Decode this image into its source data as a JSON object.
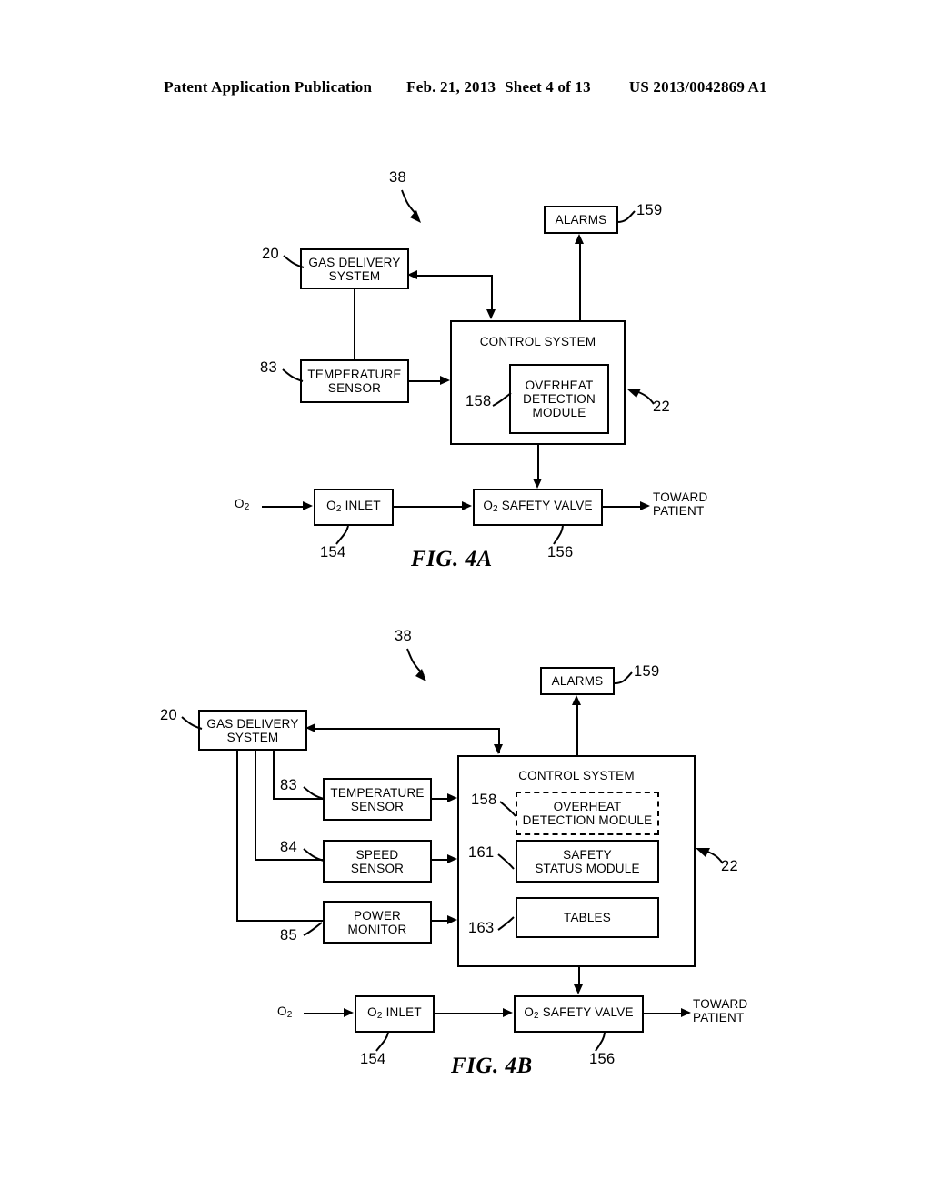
{
  "header": {
    "publication": "Patent Application Publication",
    "date": "Feb. 21, 2013",
    "sheet": "Sheet 4 of 13",
    "docnum": "US 2013/0042869 A1"
  },
  "figures": [
    {
      "id": "fig4a",
      "caption": "FIG. 4A",
      "system_ref": "38",
      "nodes": {
        "gas_delivery": {
          "label": "GAS DELIVERY\nSYSTEM",
          "ref": "20"
        },
        "temperature_sensor": {
          "label": "TEMPERATURE\nSENSOR",
          "ref": "83"
        },
        "alarms": {
          "label": "ALARMS",
          "ref": "159"
        },
        "control_system": {
          "label": "CONTROL SYSTEM",
          "ref": "22"
        },
        "overheat_module": {
          "label": "OVERHEAT\nDETECTION\nMODULE",
          "ref": "158"
        },
        "o2_inlet": {
          "label": "O2 INLET",
          "ref": "154"
        },
        "o2_safety_valve": {
          "label": "O2 SAFETY VALVE",
          "ref": "156"
        }
      },
      "texts": {
        "o2_source": "O2",
        "toward_patient": "TOWARD\nPATIENT"
      }
    },
    {
      "id": "fig4b",
      "caption": "FIG. 4B",
      "system_ref": "38",
      "nodes": {
        "gas_delivery": {
          "label": "GAS DELIVERY\nSYSTEM",
          "ref": "20"
        },
        "temperature_sensor": {
          "label": "TEMPERATURE\nSENSOR",
          "ref": "83"
        },
        "speed_sensor": {
          "label": "SPEED\nSENSOR",
          "ref": "84"
        },
        "power_monitor": {
          "label": "POWER\nMONITOR",
          "ref": "85"
        },
        "alarms": {
          "label": "ALARMS",
          "ref": "159"
        },
        "control_system": {
          "label": "CONTROL SYSTEM",
          "ref": "22"
        },
        "overheat_module": {
          "label": "OVERHEAT\nDETECTION MODULE",
          "ref": "158"
        },
        "safety_status_module": {
          "label": "SAFETY\nSTATUS MODULE",
          "ref": "161"
        },
        "tables_module": {
          "label": "TABLES",
          "ref": "163"
        },
        "o2_inlet": {
          "label": "O2 INLET",
          "ref": "154"
        },
        "o2_safety_valve": {
          "label": "O2 SAFETY VALVE",
          "ref": "156"
        }
      },
      "texts": {
        "o2_source": "O2",
        "toward_patient": "TOWARD\nPATIENT"
      }
    }
  ],
  "colors": {
    "ink": "#000000",
    "paper": "#ffffff"
  }
}
